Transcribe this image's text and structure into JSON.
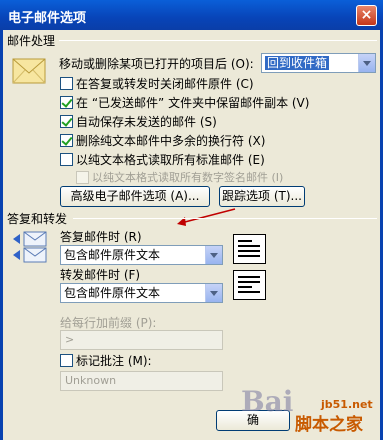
{
  "window": {
    "title": "电子邮件选项",
    "close": "×"
  },
  "mail_handling": {
    "heading": "邮件处理",
    "after_move_label": "移动或删除某项已打开的项目后 (O):",
    "after_move_value": "回到收件箱",
    "options": [
      {
        "label": "在答复或转发时关闭邮件原件 (C)",
        "checked": false,
        "disabled": false
      },
      {
        "label": "在 “已发送邮件” 文件夹中保留邮件副本 (V)",
        "checked": true,
        "disabled": false
      },
      {
        "label": "自动保存未发送的邮件 (S)",
        "checked": true,
        "disabled": false
      },
      {
        "label": "删除纯文本邮件中多余的换行符 (X)",
        "checked": true,
        "disabled": false
      },
      {
        "label": "以纯文本格式读取所有标准邮件 (E)",
        "checked": false,
        "disabled": false
      },
      {
        "label": "以纯文本格式读取所有数字签名邮件 (I)",
        "checked": false,
        "disabled": true
      }
    ],
    "advanced_button": "高级电子邮件选项 (A)...",
    "tracking_button": "跟踪选项 (T)..."
  },
  "reply_forward": {
    "heading": "答复和转发",
    "reply_label": "答复邮件时 (R)",
    "reply_value": "包含邮件原件文本",
    "forward_label": "转发邮件时 (F)",
    "forward_value": "包含邮件原件文本",
    "prefix_label": "给每行加前缀 (P):",
    "prefix_value": ">",
    "annotate_label": "标记批注 (M):",
    "annotate_checked": false,
    "annotate_value": "Unknown"
  },
  "footer": {
    "ok_button": "确"
  },
  "watermarks": {
    "brand": "Bai",
    "site": "jb51.net",
    "site_name": "脚本之家"
  }
}
